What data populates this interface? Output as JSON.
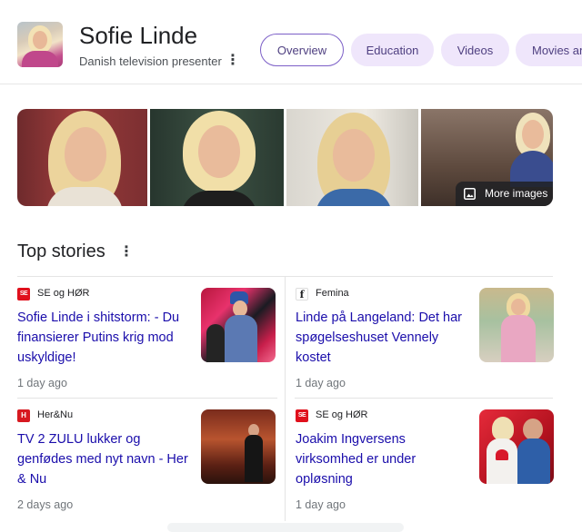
{
  "header": {
    "title": "Sofie Linde",
    "subtitle": "Danish television presenter",
    "more_icon": "more-vert-icon",
    "tabs": [
      {
        "label": "Overview",
        "active": true
      },
      {
        "label": "Education",
        "active": false
      },
      {
        "label": "Videos",
        "active": false
      },
      {
        "label": "Movies and TV shows",
        "active": false
      }
    ]
  },
  "images": {
    "more_label": "More images",
    "more_icon": "image-icon"
  },
  "top_stories": {
    "title": "Top stories",
    "more_icon": "more-vert-icon",
    "stories": [
      {
        "source": "SE og HØR",
        "headline": "Sofie Linde i shitstorm: - Du finansierer Putins krig mod uskyldige!",
        "age": "1 day ago"
      },
      {
        "source": "Femina",
        "headline": "Linde på Langeland: Det har spøgelseshuset Vennely kostet",
        "age": "1 day ago"
      },
      {
        "source": "Her&Nu",
        "headline": "TV 2 ZULU lukker og genfødes med nyt navn - Her & Nu",
        "age": "2 days ago"
      },
      {
        "source": "SE og HØR",
        "headline": "Joakim Ingversens virksomhed er under opløsning",
        "age": "1 day ago"
      }
    ]
  },
  "colors": {
    "link": "#1a0dab",
    "chip_bg": "#efe6fb",
    "chip_text": "#4e3f80",
    "chip_active_border": "#7c5fc7"
  }
}
